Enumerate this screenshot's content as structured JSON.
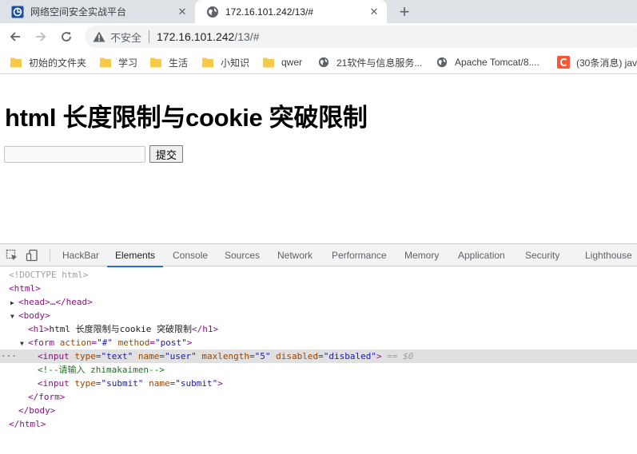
{
  "tabs": [
    {
      "title": "网络空间安全实战平台",
      "active": false
    },
    {
      "title": "172.16.101.242/13/#",
      "active": true
    }
  ],
  "toolbar": {
    "insecure_label": "不安全",
    "url_host": "172.16.101.242",
    "url_path": "/13/#"
  },
  "bookmarks": [
    {
      "label": "初始的文件夹",
      "icon": "folder-icon"
    },
    {
      "label": "学习",
      "icon": "folder-icon"
    },
    {
      "label": "生活",
      "icon": "folder-icon"
    },
    {
      "label": "小知识",
      "icon": "folder-icon"
    },
    {
      "label": "qwer",
      "icon": "folder-icon"
    },
    {
      "label": "21软件与信息服务...",
      "icon": "globe-icon"
    },
    {
      "label": "Apache Tomcat/8....",
      "icon": "globe-icon"
    },
    {
      "label": "(30条消息) jav",
      "icon": "csdn-icon"
    }
  ],
  "page": {
    "heading": "html 长度限制与cookie 突破限制",
    "submit_label": "提交",
    "input_value": ""
  },
  "devtools": {
    "tabs": [
      "HackBar",
      "Elements",
      "Console",
      "Sources",
      "Network",
      "Performance",
      "Memory",
      "Application",
      "Security",
      "Lighthouse"
    ],
    "active_tab": "Elements",
    "dom": {
      "doctype": "<!DOCTYPE html>",
      "html_open": "<html>",
      "head_collapsed": "<head>…</head>",
      "body_open": "<body>",
      "h1_open": "<h1>",
      "h1_text": "html 长度限制与cookie 突破限制",
      "h1_close": "</h1>",
      "form_tag": "form",
      "form_action_name": "action",
      "form_action_value": "\"#\"",
      "form_method_name": "method",
      "form_method_value": "\"post\"",
      "input1_tag": "input",
      "input1_type_name": "type",
      "input1_type_value": "\"text\"",
      "input1_name_name": "name",
      "input1_name_value": "\"user\"",
      "input1_maxlength_name": "maxlength",
      "input1_maxlength_value": "\"5\"",
      "input1_disabled_name": "disabled",
      "input1_disabled_value": "\"disbaled\"",
      "selected_marker": "== $0",
      "comment": "<!--请输入 zhimakaimen-->",
      "input2_tag": "input",
      "input2_type_name": "type",
      "input2_type_value": "\"submit\"",
      "input2_name_name": "name",
      "input2_name_value": "\"submit\"",
      "form_close": "</form>",
      "body_close": "</body>",
      "html_close": "</html>",
      "ellipsis": "···"
    }
  },
  "colors": {
    "tag": "#881280",
    "attribute": "#994500",
    "value": "#1a1aa6",
    "comment": "#236e25",
    "active_tab_underline": "#1a73e8",
    "folder": "#f7c948"
  }
}
